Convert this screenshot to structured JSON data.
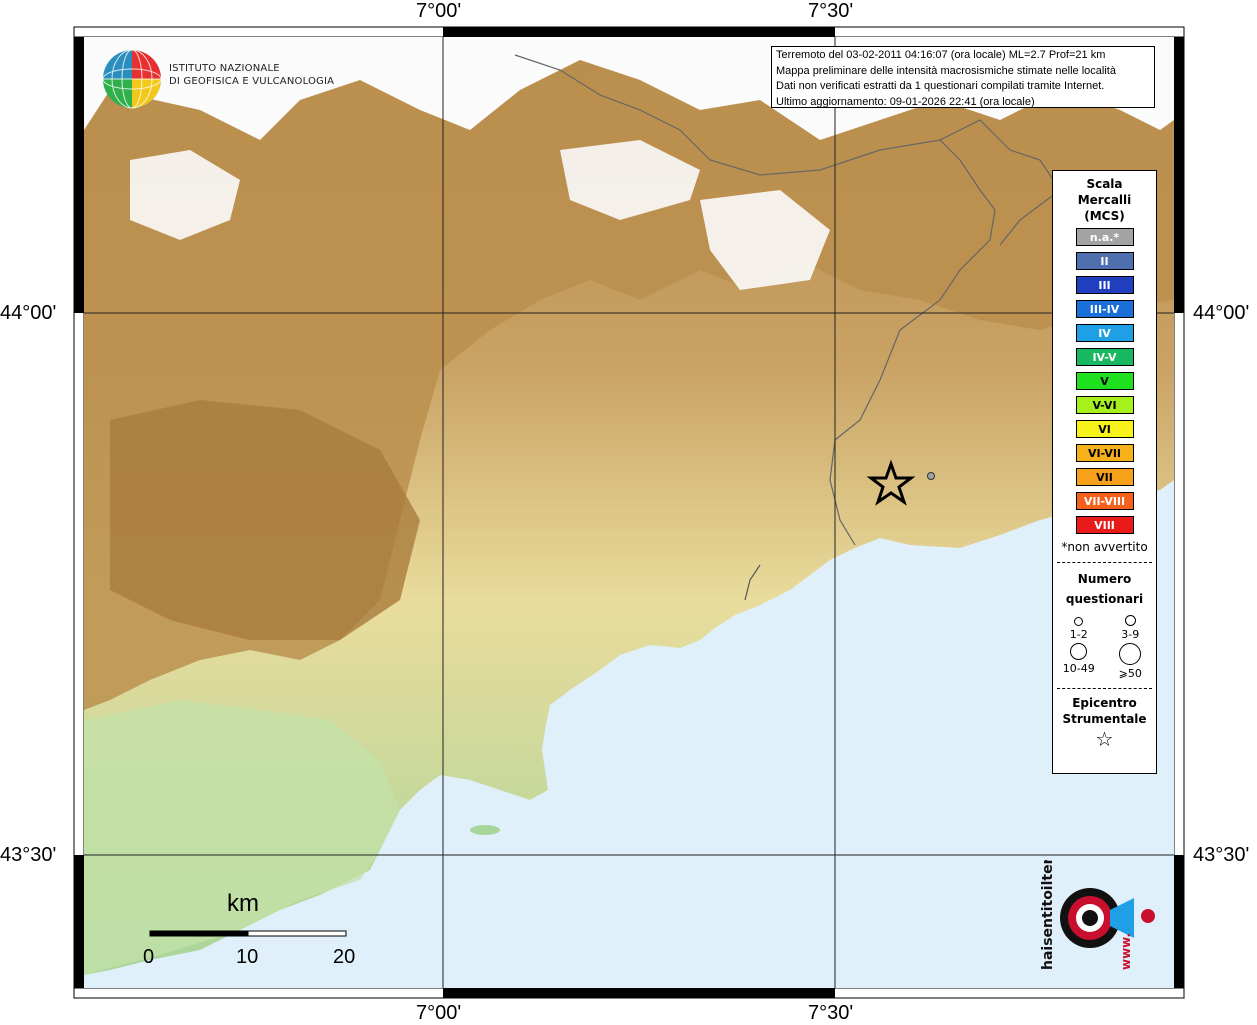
{
  "header": {
    "info_lines": [
      "Terremoto del 03-02-2011 04:16:07 (ora locale) ML=2.7 Prof=21 km",
      "Mappa preliminare delle intensità macrosismiche stimate nelle località",
      "Dati non verificati estratti da 1 questionari compilati tramite Internet.",
      "Ultimo aggiornamento: 09-01-2026 22:41 (ora locale)"
    ]
  },
  "logos": {
    "ingv_line1": "ISTITUTO NAZIONALE",
    "ingv_line2": "DI GEOFISICA E VULCANOLOGIA",
    "hsit_text": "haisentitoilterremoto.it",
    "hsit_www": "www."
  },
  "coordinates": {
    "lon_top": [
      "7°00'",
      "7°30'"
    ],
    "lon_bottom": [
      "7°00'",
      "7°30'"
    ],
    "lat_left": [
      "44°00'",
      "43°30'"
    ],
    "lat_right": [
      "44°00'",
      "43°30'"
    ]
  },
  "scalebar": {
    "unit": "km",
    "ticks": [
      "0",
      "10",
      "20"
    ]
  },
  "legend": {
    "title_1": "Scala",
    "title_2": "Mercalli",
    "title_3": "(MCS)",
    "scale": [
      {
        "label": "n.a.*",
        "color": "#a3a3a3",
        "text_color": "#ffffff"
      },
      {
        "label": "II",
        "color": "#4f6fae",
        "text_color": "#ffffff"
      },
      {
        "label": "III",
        "color": "#1f3fbf",
        "text_color": "#ffffff"
      },
      {
        "label": "III-IV",
        "color": "#1a6fd8",
        "text_color": "#ffffff"
      },
      {
        "label": "IV",
        "color": "#1fa0e6",
        "text_color": "#ffffff"
      },
      {
        "label": "IV-V",
        "color": "#17b860",
        "text_color": "#ffffff"
      },
      {
        "label": "V",
        "color": "#1fe01f",
        "text_color": "#000000"
      },
      {
        "label": "V-VI",
        "color": "#a6f01c",
        "text_color": "#000000"
      },
      {
        "label": "VI",
        "color": "#f7f21a",
        "text_color": "#000000"
      },
      {
        "label": "VI-VII",
        "color": "#f5b01a",
        "text_color": "#000000"
      },
      {
        "label": "VII",
        "color": "#f7a01a",
        "text_color": "#000000"
      },
      {
        "label": "VII-VIII",
        "color": "#f5601a",
        "text_color": "#ffffff"
      },
      {
        "label": "VIII",
        "color": "#e81a1a",
        "text_color": "#ffffff"
      }
    ],
    "note": "*non avvertito",
    "questionari_title_1": "Numero",
    "questionari_title_2": "questionari",
    "questionari": [
      {
        "label": "1-2"
      },
      {
        "label": "3-9"
      },
      {
        "label": "10-49"
      },
      {
        "label": "⩾50"
      }
    ],
    "epicentro_title_1": "Epicentro",
    "epicentro_title_2": "Strumentale",
    "epicentro_symbol": "☆"
  },
  "colors": {
    "sea": "#dff0fb",
    "lowland": "#a8d59a",
    "midland": "#efe2a4",
    "upland": "#c9a264",
    "mountain": "#a97c3c",
    "snow": "#fbfbfb"
  }
}
